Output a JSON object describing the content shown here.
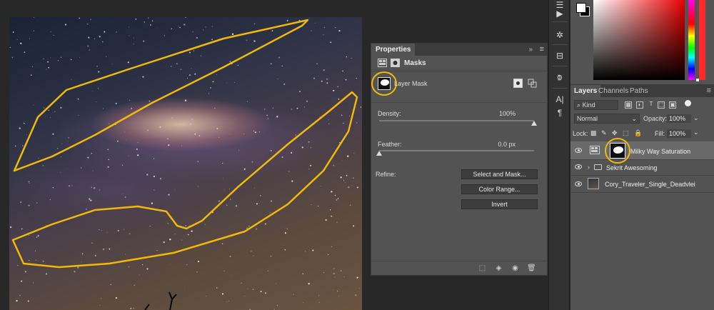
{
  "properties": {
    "tab_label": "Properties",
    "collapse_glyph": "»",
    "menu_glyph": "≡",
    "masks_label": "Masks",
    "layer_mask_label": "Layer Mask",
    "density_label": "Density:",
    "density_value": "100%",
    "density_level_percent": 100,
    "feather_label": "Feather:",
    "feather_value": "0.0 px",
    "feather_level_percent": 0,
    "refine_label": "Refine:",
    "buttons": {
      "select_and_mask": "Select and Mask...",
      "color_range": "Color Range...",
      "invert": "Invert"
    }
  },
  "layers_panel": {
    "tabs": [
      "Layers",
      "Channels",
      "Paths"
    ],
    "menu_glyph": "≡",
    "filter_kind": "Kind",
    "blend_mode": "Normal",
    "opacity_label": "Opacity:",
    "opacity_value": "100%",
    "lock_label": "Lock:",
    "fill_label": "Fill:",
    "fill_value": "100%",
    "layers": [
      {
        "name": "Milky Way Saturation",
        "selected": true
      },
      {
        "name": "Sekrit Awesoming",
        "selected": false
      },
      {
        "name": "Cory_Traveler_Single_Deadvlei",
        "selected": false
      }
    ]
  },
  "colors": {
    "highlight": "#f2b90a",
    "panel": "#535353",
    "tabbar": "#3c3c3c",
    "background": "#282828"
  },
  "icons": {
    "toolstrip": [
      "play-icon",
      "history-icon",
      "3d-icon",
      "paths-icon",
      "character-icon",
      "paragraph-icon"
    ]
  }
}
